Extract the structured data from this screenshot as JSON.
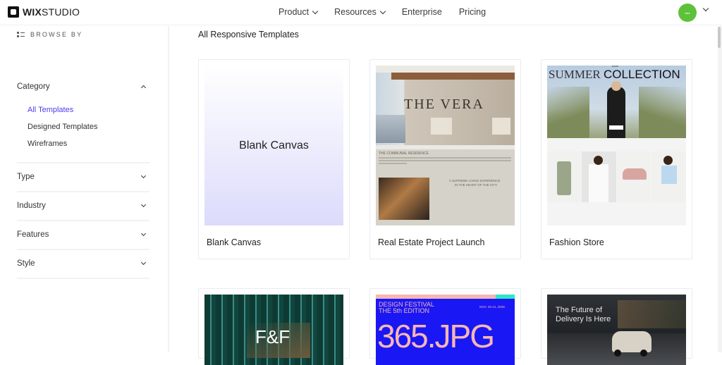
{
  "header": {
    "logo_bold": "WIX",
    "logo_light": "STUDIO",
    "nav": [
      {
        "label": "Product",
        "has_dropdown": true
      },
      {
        "label": "Resources",
        "has_dropdown": true
      },
      {
        "label": "Enterprise",
        "has_dropdown": false
      },
      {
        "label": "Pricing",
        "has_dropdown": false
      }
    ],
    "avatar_color": "#5ec13a"
  },
  "sidebar": {
    "browse_label": "BROWSE BY",
    "category": {
      "label": "Category",
      "expanded": true,
      "items": [
        {
          "label": "All Templates",
          "active": true
        },
        {
          "label": "Designed Templates",
          "active": false
        },
        {
          "label": "Wireframes",
          "active": false
        }
      ]
    },
    "filters": [
      {
        "label": "Type"
      },
      {
        "label": "Industry"
      },
      {
        "label": "Features"
      },
      {
        "label": "Style"
      }
    ],
    "accent_color": "#4d3df0"
  },
  "main": {
    "title": "All Responsive Templates",
    "templates": [
      {
        "name": "Blank Canvas",
        "thumb_text": "Blank Canvas"
      },
      {
        "name": "Real Estate Project Launch",
        "thumb_title": "THE VERA",
        "thumb_heading": "THE COMMUNAL RESIDENCE",
        "thumb_tagline_1": "A SUPREME LIVING EXPERIENCE",
        "thumb_tagline_2": "IN THE HEART OF THE CITY"
      },
      {
        "name": "Fashion Store",
        "thumb_title_1": "SUMMER",
        "thumb_title_2": "COLLECTION",
        "thumb_brand": "BARE"
      },
      {
        "name": "",
        "thumb_title": "F&F"
      },
      {
        "name": "",
        "thumb_title_1": "DESIGN FESTIVAL",
        "thumb_title_2": "THE 5th EDITION",
        "thumb_date": "NOV. 20-21, 2035",
        "thumb_big": "365.JPG"
      },
      {
        "name": "",
        "thumb_title_1": "The Future of",
        "thumb_title_2": "Delivery Is Here"
      }
    ]
  }
}
